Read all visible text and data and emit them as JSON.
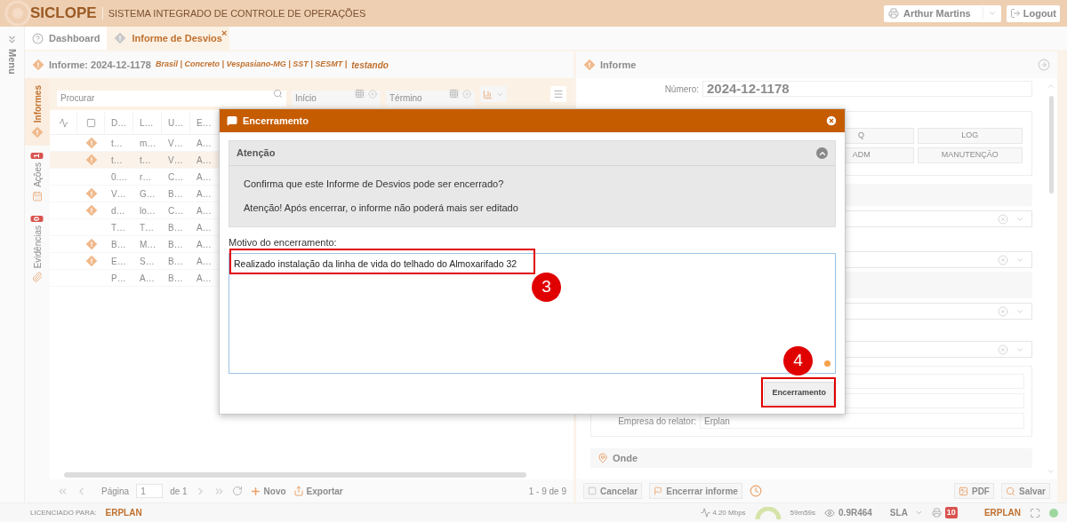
{
  "header": {
    "logo": "SICLOPE",
    "title": "SISTEMA INTEGRADO DE CONTROLE DE OPERAÇÕES",
    "user": "Arthur Martins",
    "logout": "Logout"
  },
  "menu": {
    "label": "Menu"
  },
  "tabs": [
    {
      "label": "Dashboard",
      "selected": false
    },
    {
      "label": "Informe de Desvios",
      "selected": true,
      "close": "×"
    }
  ],
  "left_panel": {
    "title": "Informe: 2024-12-1178",
    "subtitle": "Brasil | Concreto | Vespasiano-MG | SST | SESMT |",
    "tag": "testando",
    "side_tabs": [
      {
        "label": "Informes",
        "selected": true
      },
      {
        "label": "Ações",
        "count": "1",
        "selected": false
      },
      {
        "label": "Evidências",
        "count": "0",
        "selected": false
      }
    ],
    "search": {
      "placeholder": "Procurar"
    },
    "start": {
      "placeholder": "Início"
    },
    "end": {
      "placeholder": "Término"
    },
    "table": {
      "columns": [
        "D…",
        "L…",
        "U…",
        "E…"
      ],
      "rows": [
        {
          "flagged": true,
          "selected": false,
          "cells": [
            "t…",
            "m…",
            "V…",
            "A…"
          ]
        },
        {
          "flagged": true,
          "selected": true,
          "cells": [
            "t…",
            "t…",
            "V…",
            "A…"
          ]
        },
        {
          "flagged": false,
          "selected": false,
          "cells": [
            "0.…",
            "r…",
            "C…",
            "A…"
          ]
        },
        {
          "flagged": true,
          "selected": false,
          "cells": [
            "V…",
            "G…",
            "B…",
            "A…"
          ]
        },
        {
          "flagged": true,
          "selected": false,
          "cells": [
            "d…",
            "lo…",
            "C…",
            "A…"
          ]
        },
        {
          "flagged": false,
          "selected": false,
          "cells": [
            "T…",
            "T…",
            "B…",
            "A…"
          ]
        },
        {
          "flagged": true,
          "selected": false,
          "cells": [
            "B…",
            "M…",
            "B…",
            "A…"
          ]
        },
        {
          "flagged": true,
          "selected": false,
          "cells": [
            "E…",
            "S…",
            "B…",
            "A…"
          ]
        },
        {
          "flagged": false,
          "selected": false,
          "cells": [
            "P…",
            "A…",
            "B…",
            "A…"
          ]
        }
      ]
    },
    "pagination": {
      "page_label": "Página",
      "page": "1",
      "of": "de 1",
      "new": "Novo",
      "export": "Exportar",
      "range": "1 - 9 de 9"
    }
  },
  "right_panel": {
    "title": "Informe",
    "number_label": "Número:",
    "number": "2024-12-1178",
    "buttons": [
      "Q",
      "LOG",
      "ADM",
      "MANUTENÇÃO"
    ],
    "reporter_label": "Empresa do relator:",
    "reporter": "Erplan",
    "where": "Onde",
    "actions": {
      "cancel": "Cancelar",
      "close": "Encerrar informe",
      "pdf": "PDF",
      "save": "Salvar"
    }
  },
  "status_bar": {
    "licensed": "LICENCIADO PARA:",
    "brand": "ERPLAN",
    "speed": "4.20 Mbps",
    "timer": "59m59s",
    "version": "0.9R464",
    "sla": "SLA",
    "count": "10",
    "brand_right": "ERPLAN"
  },
  "dialog": {
    "title": "Encerramento",
    "notice": {
      "title": "Atenção",
      "expanded": true,
      "lines": [
        "Confirma que este Informe de Desvios pode ser encerrado?",
        "Atenção! Após encerrar, o informe não poderá mais ser editado"
      ]
    },
    "reason_label": "Motivo do encerramento:",
    "reason": "Realizado instalação da linha de vida do telhado do Almoxarifado 32",
    "submit": "Encerramento",
    "reason_callout": "3",
    "submit_callout": "4"
  }
}
